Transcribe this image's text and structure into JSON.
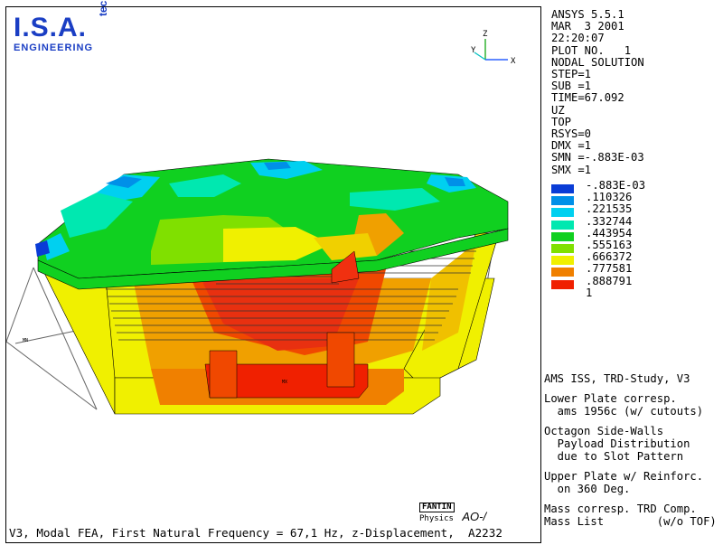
{
  "logo": {
    "main": "I.S.A.",
    "tec": "tec",
    "sub": "ENGINEERING"
  },
  "triad": {
    "z": "Z",
    "y": "Y",
    "x": "X"
  },
  "info_lines": [
    "ANSYS 5.5.1",
    "MAR  3 2001",
    "22:20:07",
    "PLOT NO.   1",
    "NODAL SOLUTION",
    "STEP=1",
    "SUB =1",
    "TIME=67.092",
    "UZ",
    "TOP",
    "RSYS=0",
    "DMX =1",
    "SMN =-.883E-03",
    "SMX =1"
  ],
  "chart_data": {
    "type": "heatmap",
    "title": "NODAL SOLUTION",
    "quantity": "UZ",
    "legend": {
      "labels": [
        "-.883E-03",
        ".110326",
        ".221535",
        ".332744",
        ".443954",
        ".555163",
        ".666372",
        ".777581",
        ".888791",
        "1"
      ],
      "colors": [
        "#0a3cd6",
        "#0090e8",
        "#00d0f0",
        "#00e8b0",
        "#10d020",
        "#80e000",
        "#f0f000",
        "#f08000",
        "#f02000"
      ]
    },
    "min": -0.000883,
    "max": 1,
    "mesh_labels": [
      "MX",
      "MN"
    ]
  },
  "caption": "V3, Modal FEA, First Natural Frequency = 67,1 Hz, z-Displacement,  A2232",
  "stamp": {
    "box": "FANTIN",
    "sub": "Physics",
    "ao": "AO-/"
  },
  "notes": [
    "AMS ISS, TRD-Study, V3",
    "Lower Plate corresp.\n  ams 1956c (w/ cutouts)",
    "Octagon Side-Walls\n  Payload Distribution\n  due to Slot Pattern",
    "Upper Plate w/ Reinforc.\n  on 360 Deg.",
    "Mass corresp. TRD Comp.\nMass List        (w/o TOF)"
  ]
}
